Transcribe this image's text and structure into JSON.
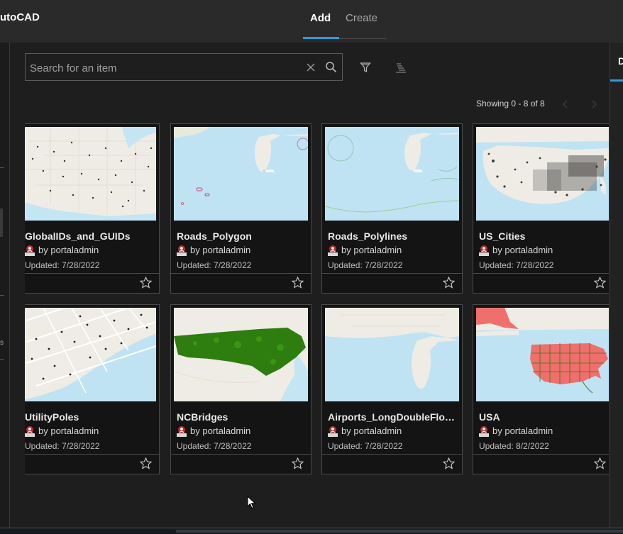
{
  "app": {
    "title": "utoCAD"
  },
  "tabs": [
    {
      "label": "Add",
      "active": true
    },
    {
      "label": "Create",
      "active": false
    }
  ],
  "right_panel": {
    "tab_label": "D"
  },
  "left_rail": {
    "clipped_text": "s"
  },
  "search": {
    "placeholder": "Search for an item",
    "value": ""
  },
  "toolbar": {
    "icons": [
      "filter-icon",
      "sort-icon"
    ]
  },
  "paging": {
    "showing": "Showing 0 - 8 of 8"
  },
  "items": [
    {
      "title": "GlobalIDs_and_GUIDs",
      "owner": "by portaladmin",
      "updated": "Updated: 7/28/2022",
      "thumb": "us-points"
    },
    {
      "title": "Roads_Polygon",
      "owner": "by portaladmin",
      "updated": "Updated: 7/28/2022",
      "thumb": "florida-polygons"
    },
    {
      "title": "Roads_Polylines",
      "owner": "by portaladmin",
      "updated": "Updated: 7/28/2022",
      "thumb": "florida-lines"
    },
    {
      "title": "US_Cities",
      "owner": "by portaladmin",
      "updated": "Updated: 7/28/2022",
      "thumb": "us-cities"
    },
    {
      "title": "UtilityPoles",
      "owner": "by portaladmin",
      "updated": "Updated: 7/28/2022",
      "thumb": "city-streets"
    },
    {
      "title": "NCBridges",
      "owner": "by portaladmin",
      "updated": "Updated: 7/28/2022",
      "thumb": "nc-bridges"
    },
    {
      "title": "Airports_LongDoubleFloat...",
      "owner": "by portaladmin",
      "updated": "Updated: 7/28/2022",
      "thumb": "florida-basemap"
    },
    {
      "title": "USA",
      "owner": "by portaladmin",
      "updated": "Updated: 8/2/2022",
      "thumb": "usa-states"
    }
  ],
  "colors": {
    "accent": "#2d9bdc",
    "background": "#1e1e1e",
    "card": "#141414",
    "water": "#bfe3f3",
    "land": "#eeece5",
    "bridges": "#2e7d0f",
    "states_fill": "#ef6f6c"
  }
}
